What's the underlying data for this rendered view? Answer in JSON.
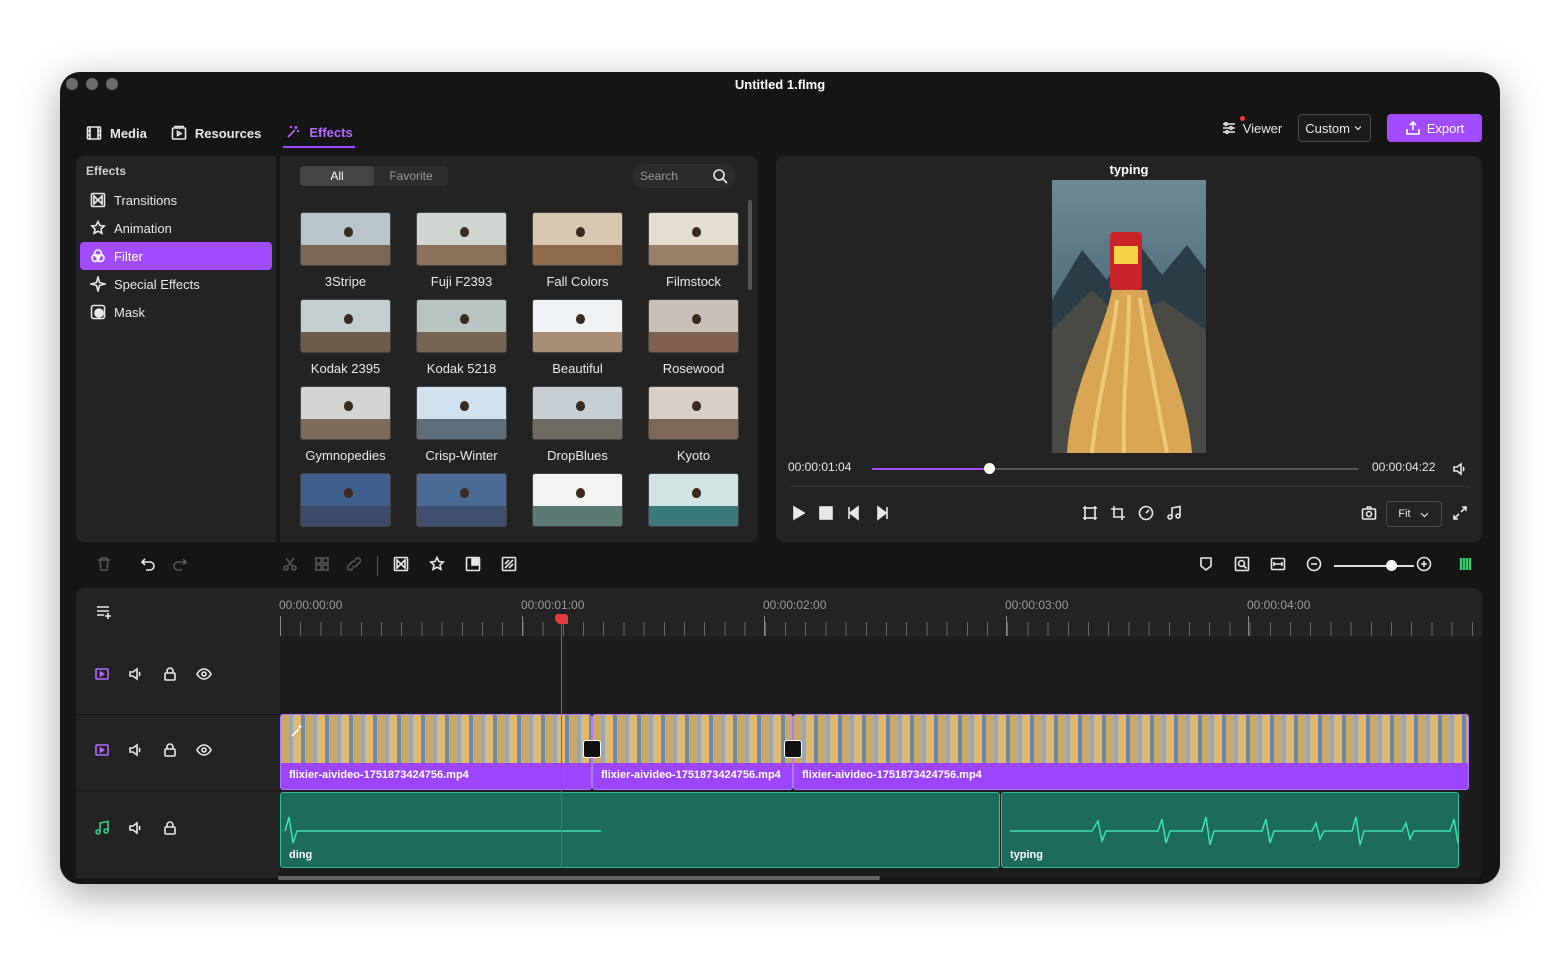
{
  "window": {
    "title": "Untitled 1.flmg"
  },
  "nav": {
    "media": "Media",
    "resources": "Resources",
    "effects": "Effects"
  },
  "topright": {
    "viewer": "Viewer",
    "custom": "Custom",
    "export": "Export"
  },
  "sidebar": {
    "heading": "Effects",
    "items": [
      {
        "label": "Transitions",
        "icon": "transitions-icon"
      },
      {
        "label": "Animation",
        "icon": "animation-icon"
      },
      {
        "label": "Filter",
        "icon": "filter-icon",
        "active": true
      },
      {
        "label": "Special Effects",
        "icon": "sparkle-icon"
      },
      {
        "label": "Mask",
        "icon": "mask-icon"
      }
    ]
  },
  "filters": {
    "tab_all": "All",
    "tab_favorite": "Favorite",
    "search_placeholder": "Search",
    "items": [
      {
        "label": "3Stripe",
        "sky": "#b8c6cc",
        "land": "#7a6652"
      },
      {
        "label": "Fuji F2393",
        "sky": "#cfd6d2",
        "land": "#8a7158"
      },
      {
        "label": "Fall Colors",
        "sky": "#d8c8b0",
        "land": "#8f6a48"
      },
      {
        "label": "Filmstock",
        "sky": "#e4ddd2",
        "land": "#9a7f66"
      },
      {
        "label": "Kodak 2395",
        "sky": "#c4cdd0",
        "land": "#6e5a48"
      },
      {
        "label": "Kodak 5218",
        "sky": "#b9c3c2",
        "land": "#776451"
      },
      {
        "label": "Beautiful",
        "sky": "#eef2f4",
        "land": "#a78d74"
      },
      {
        "label": "Rosewood",
        "sky": "#c9bfb8",
        "land": "#80604f"
      },
      {
        "label": "Gymnopedies",
        "sky": "#d2d4d2",
        "land": "#7d6a58"
      },
      {
        "label": "Crisp-Winter",
        "sky": "#cfe2ee",
        "land": "#5d6f7c"
      },
      {
        "label": "DropBlues",
        "sky": "#c7cfd4",
        "land": "#6f6a62"
      },
      {
        "label": "Kyoto",
        "sky": "#d8cfc6",
        "land": "#7e6757"
      },
      {
        "label": "",
        "sky": "#3e5f8c",
        "land": "#3b4a6a"
      },
      {
        "label": "",
        "sky": "#4a6b94",
        "land": "#3f4f70"
      },
      {
        "label": "",
        "sky": "#f2f4f2",
        "land": "#5c7a74"
      },
      {
        "label": "",
        "sky": "#d0e4e4",
        "land": "#3b7a7c"
      }
    ]
  },
  "preview": {
    "title": "typing",
    "current_time": "00:00:01:04",
    "total_time": "00:00:04:22",
    "progress": 0.24,
    "fit": "Fit"
  },
  "timeline": {
    "ruler": [
      "00:00:00:00",
      "00:00:01:00",
      "00:00:02:00",
      "00:00:03:00",
      "00:00:04:00"
    ],
    "video_clips": [
      {
        "name": "flixier-aivideo-1751873424756.mp4"
      },
      {
        "name": "flixier-aivideo-1751873424756.mp4"
      },
      {
        "name": "flixier-aivideo-1751873424756.mp4"
      }
    ],
    "audio_clips": [
      {
        "name": "ding"
      },
      {
        "name": "typing"
      }
    ]
  },
  "colors": {
    "accent": "#a24cff",
    "audio": "#1c6b5c",
    "playhead": "#e23b3b"
  }
}
